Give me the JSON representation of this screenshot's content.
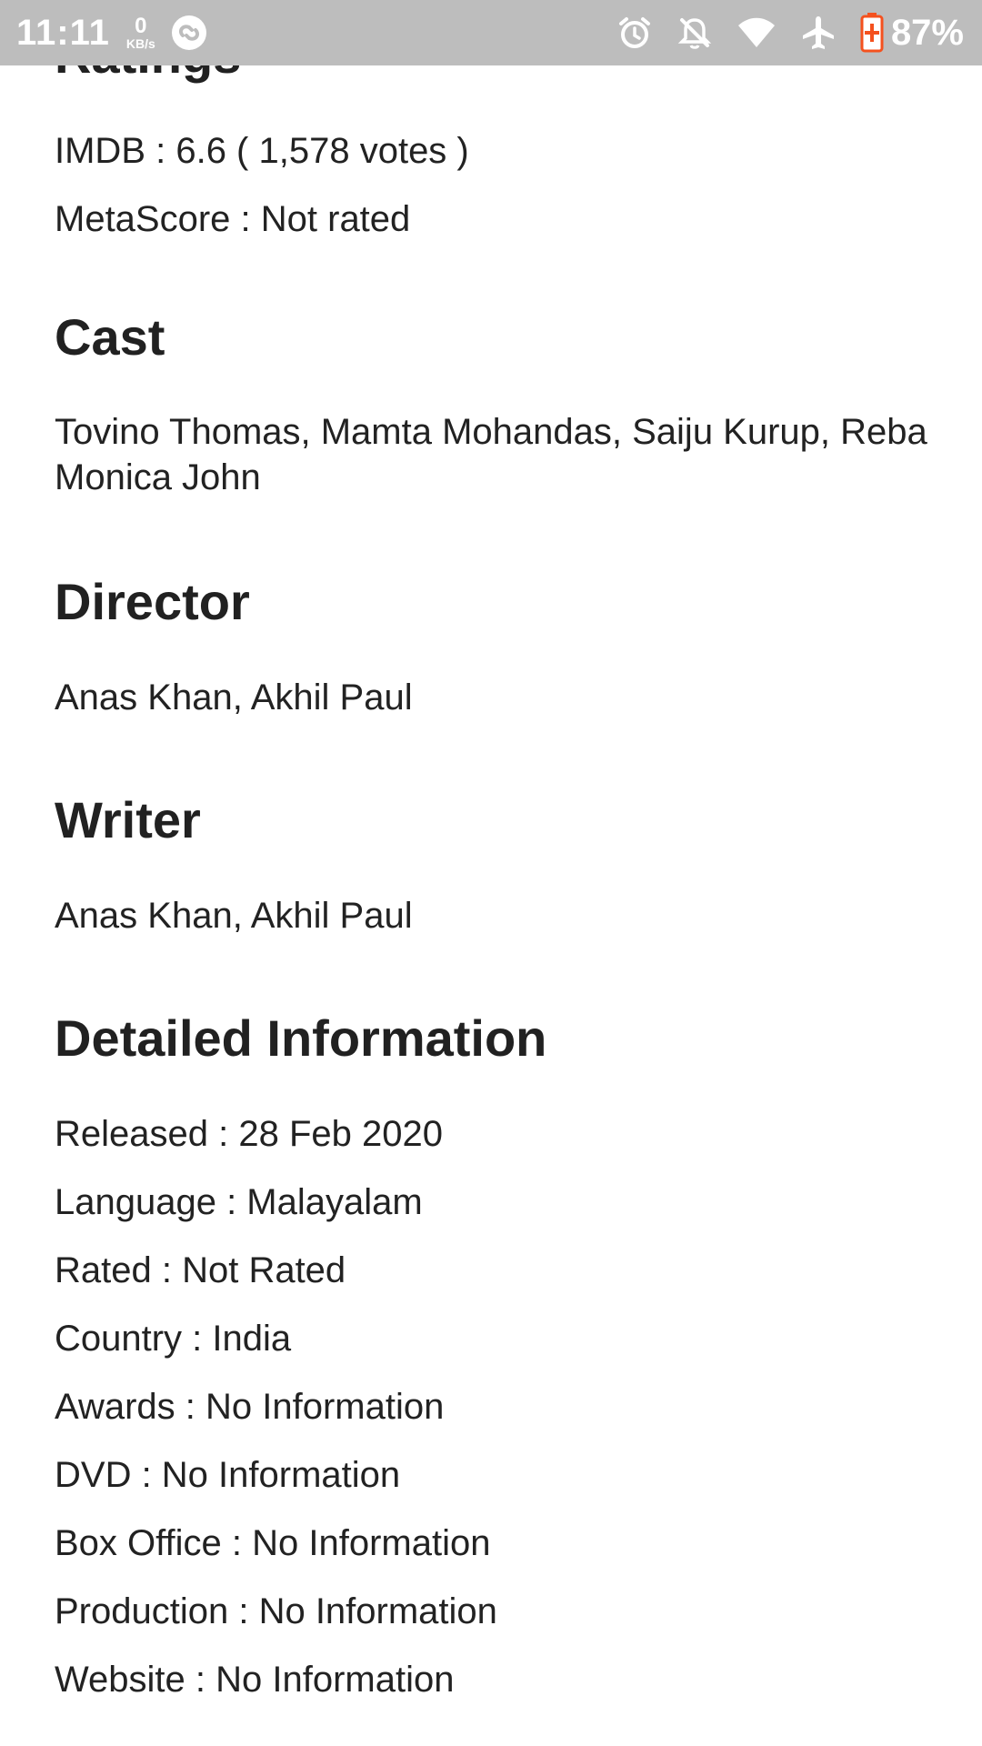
{
  "status_bar": {
    "time": "11:11",
    "net_speed_value": "0",
    "net_speed_unit": "KB/s",
    "battery_percent": "87%",
    "icons": [
      "shazam-icon",
      "alarm-icon",
      "notifications-off-icon",
      "wifi-icon",
      "airplane-mode-icon",
      "battery-charging-icon"
    ],
    "battery_color": "#f4511e"
  },
  "ratings": {
    "title": "Ratings",
    "imdb": "IMDB : 6.6 ( 1,578 votes )",
    "metascore": "MetaScore : Not rated"
  },
  "cast": {
    "title": "Cast",
    "names_line1": "Tovino Thomas, Mamta Mohandas, Saiju Kurup, Reba",
    "names_line2": "Monica John"
  },
  "director": {
    "title": "Director",
    "names": "Anas Khan, Akhil Paul"
  },
  "writer": {
    "title": "Writer",
    "names": "Anas Khan, Akhil Paul"
  },
  "detailed_information": {
    "title": "Detailed Information",
    "items": [
      "Released : 28 Feb 2020",
      "Language : Malayalam",
      "Rated : Not Rated",
      "Country : India",
      "Awards : No Information",
      "DVD : No Information",
      "Box Office : No Information",
      "Production : No Information",
      "Website : No Information"
    ]
  }
}
